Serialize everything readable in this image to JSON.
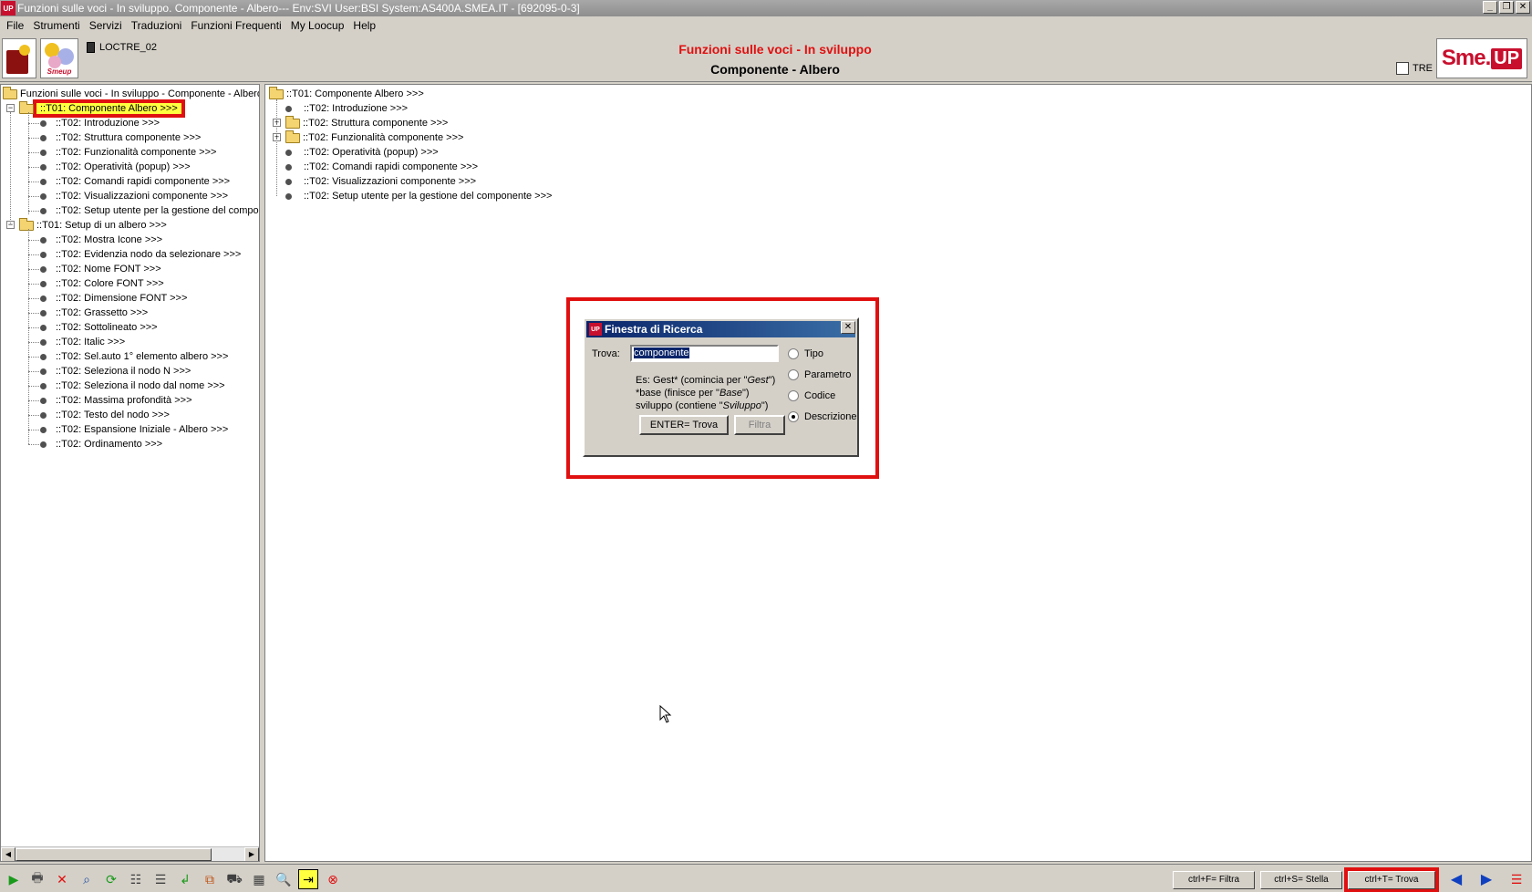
{
  "window": {
    "title": "Funzioni sulle voci - In sviluppo. Componente - Albero--- Env:SVI User:BSI System:AS400A.SMEA.IT - [692095-0-3]",
    "app_icon": "UP"
  },
  "menu": [
    "File",
    "Strumenti",
    "Servizi",
    "Traduzioni",
    "Funzioni Frequenti",
    "My Loocup",
    "Help"
  ],
  "header": {
    "loctre": "LOCTRE_02",
    "title": "Funzioni sulle voci - In sviluppo",
    "subtitle": "Componente - Albero",
    "tre_label": "TRE",
    "logo_text": "Smeup",
    "brand_left": "Sme.",
    "brand_right": "UP"
  },
  "left_tree": {
    "root": "Funzioni sulle voci - In sviluppo - Componente - Albero",
    "nodes": [
      {
        "label": "::T01: Componente Albero >>>",
        "level": 1,
        "selected": true
      },
      {
        "label": "::T02: Introduzione >>>",
        "level": 2
      },
      {
        "label": "::T02: Struttura componente >>>",
        "level": 2
      },
      {
        "label": "::T02: Funzionalità componente >>>",
        "level": 2
      },
      {
        "label": "::T02: Operatività (popup) >>>",
        "level": 2
      },
      {
        "label": "::T02: Comandi rapidi componente >>>",
        "level": 2
      },
      {
        "label": "::T02: Visualizzazioni componente >>>",
        "level": 2
      },
      {
        "label": "::T02: Setup utente per la gestione del componente >>>",
        "level": 2
      },
      {
        "label": "::T01: Setup di un albero >>>",
        "level": 1
      },
      {
        "label": "::T02: Mostra Icone >>>",
        "level": 2
      },
      {
        "label": "::T02: Evidenzia nodo da selezionare >>>",
        "level": 2
      },
      {
        "label": "::T02: Nome FONT >>>",
        "level": 2
      },
      {
        "label": "::T02: Colore FONT >>>",
        "level": 2
      },
      {
        "label": "::T02: Dimensione FONT >>>",
        "level": 2
      },
      {
        "label": "::T02: Grassetto >>>",
        "level": 2
      },
      {
        "label": "::T02: Sottolineato >>>",
        "level": 2
      },
      {
        "label": "::T02: Italic >>>",
        "level": 2
      },
      {
        "label": "::T02: Sel.auto 1° elemento albero >>>",
        "level": 2
      },
      {
        "label": "::T02: Seleziona il nodo N >>>",
        "level": 2
      },
      {
        "label": "::T02: Seleziona il nodo dal nome >>>",
        "level": 2
      },
      {
        "label": "::T02: Massima profondità >>>",
        "level": 2
      },
      {
        "label": "::T02: Testo del nodo >>>",
        "level": 2
      },
      {
        "label": "::T02: Espansione Iniziale - Albero >>>",
        "level": 2
      },
      {
        "label": "::T02: Ordinamento >>>",
        "level": 2
      }
    ]
  },
  "right_tree": {
    "root": "::T01: Componente Albero >>>",
    "nodes": [
      {
        "label": "::T02: Introduzione >>>",
        "folder": false
      },
      {
        "label": "::T02: Struttura componente >>>",
        "folder": true
      },
      {
        "label": "::T02: Funzionalità componente >>>",
        "folder": true
      },
      {
        "label": "::T02: Operatività (popup) >>>",
        "folder": false
      },
      {
        "label": "::T02: Comandi rapidi componente >>>",
        "folder": false
      },
      {
        "label": "::T02: Visualizzazioni componente >>>",
        "folder": false
      },
      {
        "label": "::T02: Setup utente per la gestione del componente >>>",
        "folder": false
      }
    ]
  },
  "dialog": {
    "title": "Finestra di Ricerca",
    "icon": "UP",
    "trova_label": "Trova:",
    "input_value": "componente",
    "hint_line1_a": "Es: Gest* (comincia per \"",
    "hint_line1_b": "Gest",
    "hint_line1_c": "\")",
    "hint_line2_a": "*base (finisce per \"",
    "hint_line2_b": "Base",
    "hint_line2_c": "\")",
    "hint_line3_a": "sviluppo (contiene \"",
    "hint_line3_b": "Sviluppo",
    "hint_line3_c": "\")",
    "radios": [
      {
        "label": "Tipo",
        "checked": false
      },
      {
        "label": "Parametro",
        "checked": false
      },
      {
        "label": "Codice",
        "checked": false
      },
      {
        "label": "Descrizione",
        "checked": true
      }
    ],
    "btn_trova": "ENTER= Trova",
    "btn_filtra": "Filtra"
  },
  "statusbar": {
    "filtra": "ctrl+F= Filtra",
    "stella": "ctrl+S= Stella",
    "trova": "ctrl+T= Trova"
  },
  "colors": {
    "highlight_red": "#e01010",
    "selection_yellow": "#ffff40",
    "brand_red": "#c8102e"
  }
}
